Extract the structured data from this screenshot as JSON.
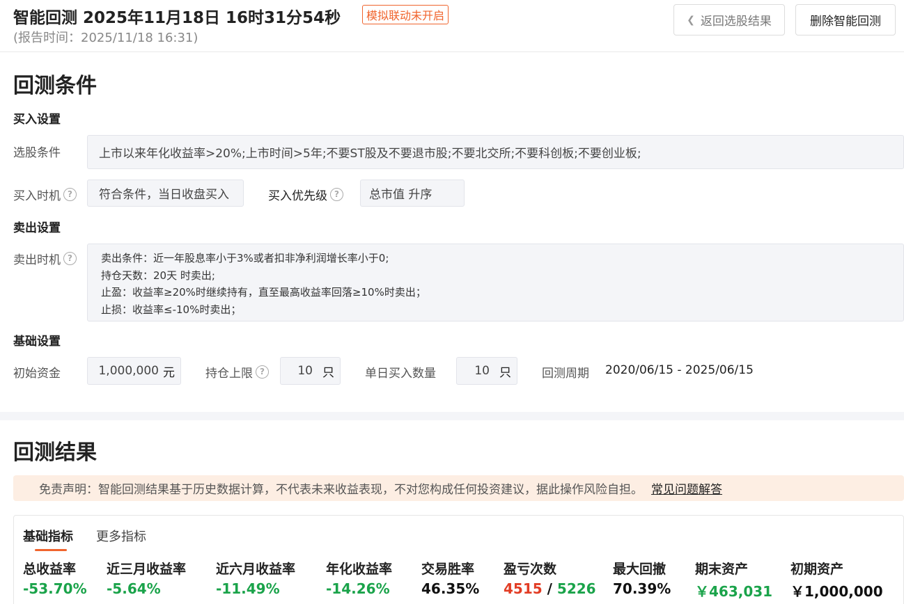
{
  "header": {
    "title": "智能回测  2025年11月18日 16时31分54秒",
    "sim_badge": "模拟联动未开启",
    "report_time": "(报告时间：2025/11/18 16:31)",
    "back_button": "返回选股结果",
    "delete_button": "删除智能回测"
  },
  "conditions": {
    "title": "回测条件",
    "buy": {
      "title": "买入设置",
      "filter_label": "选股条件",
      "filter_value": "上市以来年化收益率>20%;上市时间>5年;不要ST股及不要退市股;不要北交所;不要科创板;不要创业板;",
      "timing_label": "买入时机",
      "timing_value": "符合条件，当日收盘买入",
      "priority_label": "买入优先级",
      "priority_value": "总市值 升序"
    },
    "sell": {
      "title": "卖出设置",
      "timing_label": "卖出时机",
      "lines": [
        "卖出条件：近一年股息率小于3%或者扣非净利润增长率小于0;",
        "持仓天数：20天 时卖出;",
        "止盈：收益率≥20%时继续持有，直至最高收益率回落≥10%时卖出；",
        "止损：收益率≤-10%时卖出；"
      ]
    },
    "basic": {
      "title": "基础设置",
      "capital_label": "初始资金",
      "capital_value": "1,000,000",
      "capital_unit": "元",
      "hold_limit_label": "持仓上限",
      "hold_limit_value": "10",
      "hold_limit_unit": "只",
      "daily_buy_label": "单日买入数量",
      "daily_buy_value": "10",
      "daily_buy_unit": "只",
      "period_label": "回测周期",
      "period_value": "2020/06/15 - 2025/06/15"
    }
  },
  "results": {
    "title": "回测结果",
    "disclaimer": "免责声明：智能回测结果基于历史数据计算，不代表未来收益表现，不对您构成任何投资建议，据此操作风险自担。",
    "faq_link": "常见问题解答",
    "tabs": [
      "基础指标",
      "更多指标"
    ],
    "metrics": [
      {
        "label": "总收益率",
        "value": "-53.70%"
      },
      {
        "label": "近三月收益率",
        "value": "-5.64%"
      },
      {
        "label": "近六月收益率",
        "value": "-11.49%"
      },
      {
        "label": "年化收益率",
        "value": "-14.26%"
      },
      {
        "label": "交易胜率",
        "value": "46.35%"
      },
      {
        "label": "盈亏次数",
        "win": "4515",
        "sep": "/",
        "loss": "5226"
      },
      {
        "label": "最大回撤",
        "value": "70.39%"
      },
      {
        "label": "期末资产",
        "value": "￥463,031"
      },
      {
        "label": "初期资产",
        "value": "￥1,000,000"
      }
    ],
    "colors": {
      "positive": "#e23d25",
      "negative": "#1aa34a",
      "accent": "#f0642d"
    }
  }
}
